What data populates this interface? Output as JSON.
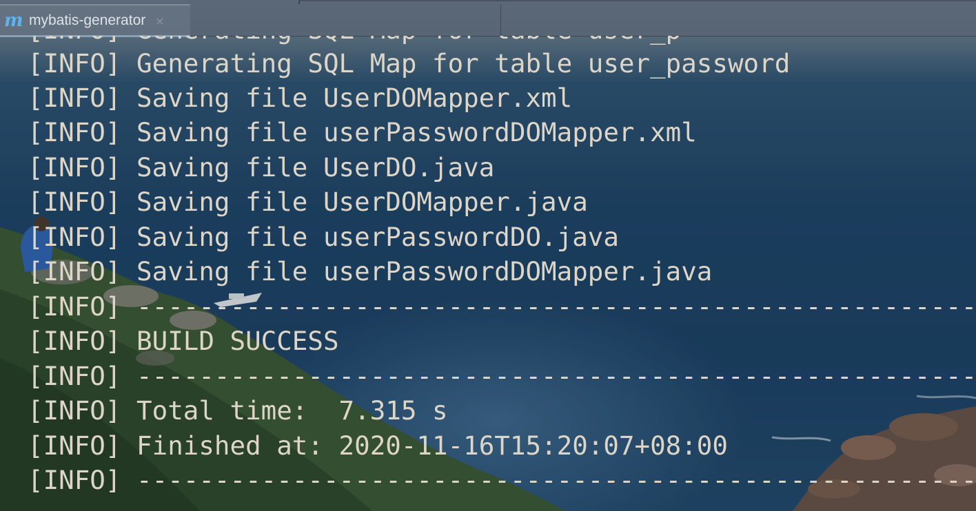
{
  "window": {
    "tab_icon": "m",
    "tab_title": "mybatis-generator",
    "tab_close": "×"
  },
  "console": {
    "partial_top_line": "[INFO] Generating SQL Map for table user_p",
    "lines": [
      "[INFO] Generating SQL Map for table user_password",
      "[INFO] Saving file UserDOMapper.xml",
      "[INFO] Saving file userPasswordDOMapper.xml",
      "[INFO] Saving file UserDO.java",
      "[INFO] Saving file UserDOMapper.java",
      "[INFO] Saving file userPasswordDO.java",
      "[INFO] Saving file userPasswordDOMapper.java",
      "[INFO] ----------------------------------------------------------",
      "[INFO] BUILD SUCCESS",
      "[INFO] ----------------------------------------------------------",
      "[INFO] Total time:  7.315 s",
      "[INFO] Finished at: 2020-11-16T15:20:07+08:00",
      "[INFO] ----------------------------------------------------------"
    ]
  },
  "colors": {
    "console_text": "#ddd6c8",
    "tab_icon": "#5fb3ee",
    "titlebar": "#58646f"
  }
}
